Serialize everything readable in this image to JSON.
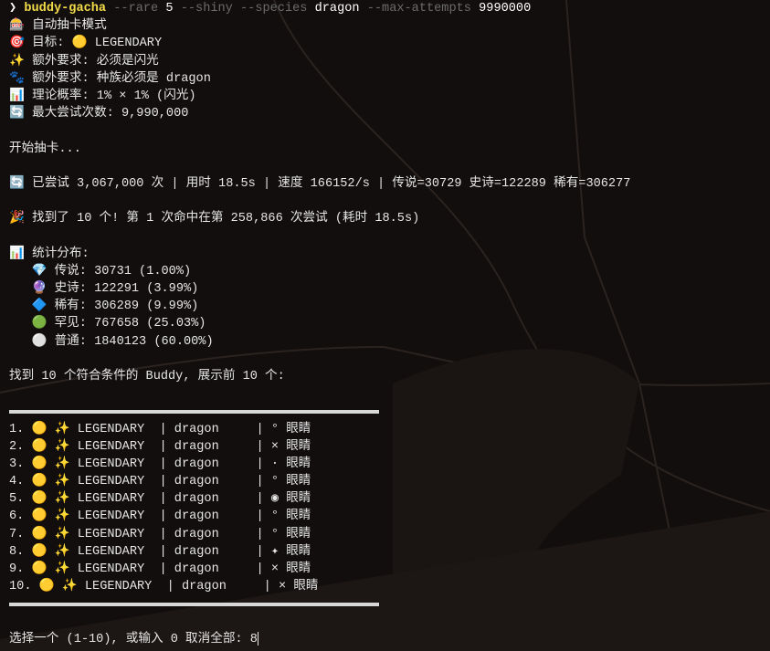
{
  "command": {
    "prompt": "❯",
    "program": "buddy-gacha",
    "flag_rare": "--rare",
    "rare_value": "5",
    "flag_shiny": "--shiny",
    "flag_species": "--species",
    "species_value": "dragon",
    "flag_max": "--max-attempts",
    "max_value": "9990000"
  },
  "header_lines": [
    {
      "icon": "🎰",
      "text": "自动抽卡模式"
    },
    {
      "icon": "🎯",
      "text": "目标: 🟡 LEGENDARY"
    },
    {
      "icon": "✨",
      "text": "额外要求: 必须是闪光"
    },
    {
      "icon": "🐾",
      "text": "额外要求: 种族必须是 dragon"
    },
    {
      "icon": "📊",
      "text": "理论概率: 1% × 1% (闪光)"
    },
    {
      "icon": "🔄",
      "text": "最大尝试次数: 9,990,000"
    }
  ],
  "start_text": "开始抽卡...",
  "progress": {
    "icon": "🔄",
    "text": "已尝试 3,067,000 次 | 用时 18.5s | 速度 166152/s | 传说=30729 史诗=122289 稀有=306277"
  },
  "found": {
    "icon": "🎉",
    "text": "找到了 10 个! 第 1 次命中在第 258,866 次尝试 (耗时 18.5s)"
  },
  "stats": {
    "icon": "📊",
    "title": "统计分布:",
    "items": [
      {
        "icon": "💎",
        "text": "传说: 30731 (1.00%)"
      },
      {
        "icon": "🔮",
        "text": "史诗: 122291 (3.99%)"
      },
      {
        "icon": "🔷",
        "text": "稀有: 306289 (9.99%)"
      },
      {
        "icon": "🟢",
        "text": "罕见: 767658 (25.03%)"
      },
      {
        "icon": "⚪",
        "text": "普通: 1840123 (60.00%)"
      }
    ]
  },
  "summary": "找到 10 个符合条件的 Buddy, 展示前 10 个:",
  "results": [
    {
      "n": "1.",
      "rarity": "LEGENDARY",
      "species": "dragon",
      "eye": "°",
      "label": "眼睛"
    },
    {
      "n": "2.",
      "rarity": "LEGENDARY",
      "species": "dragon",
      "eye": "×",
      "label": "眼睛"
    },
    {
      "n": "3.",
      "rarity": "LEGENDARY",
      "species": "dragon",
      "eye": "·",
      "label": "眼睛"
    },
    {
      "n": "4.",
      "rarity": "LEGENDARY",
      "species": "dragon",
      "eye": "°",
      "label": "眼睛"
    },
    {
      "n": "5.",
      "rarity": "LEGENDARY",
      "species": "dragon",
      "eye": "◉",
      "label": "眼睛"
    },
    {
      "n": "6.",
      "rarity": "LEGENDARY",
      "species": "dragon",
      "eye": "°",
      "label": "眼睛"
    },
    {
      "n": "7.",
      "rarity": "LEGENDARY",
      "species": "dragon",
      "eye": "°",
      "label": "眼睛"
    },
    {
      "n": "8.",
      "rarity": "LEGENDARY",
      "species": "dragon",
      "eye": "✦",
      "label": "眼睛"
    },
    {
      "n": "9.",
      "rarity": "LEGENDARY",
      "species": "dragon",
      "eye": "×",
      "label": "眼睛"
    },
    {
      "n": "10.",
      "rarity": "LEGENDARY",
      "species": "dragon",
      "eye": "×",
      "label": "眼睛"
    }
  ],
  "result_icons": {
    "rarity": "🟡",
    "shiny": "✨"
  },
  "input": {
    "prompt": "选择一个 (1-10), 或输入 0 取消全部: ",
    "value": "8"
  }
}
